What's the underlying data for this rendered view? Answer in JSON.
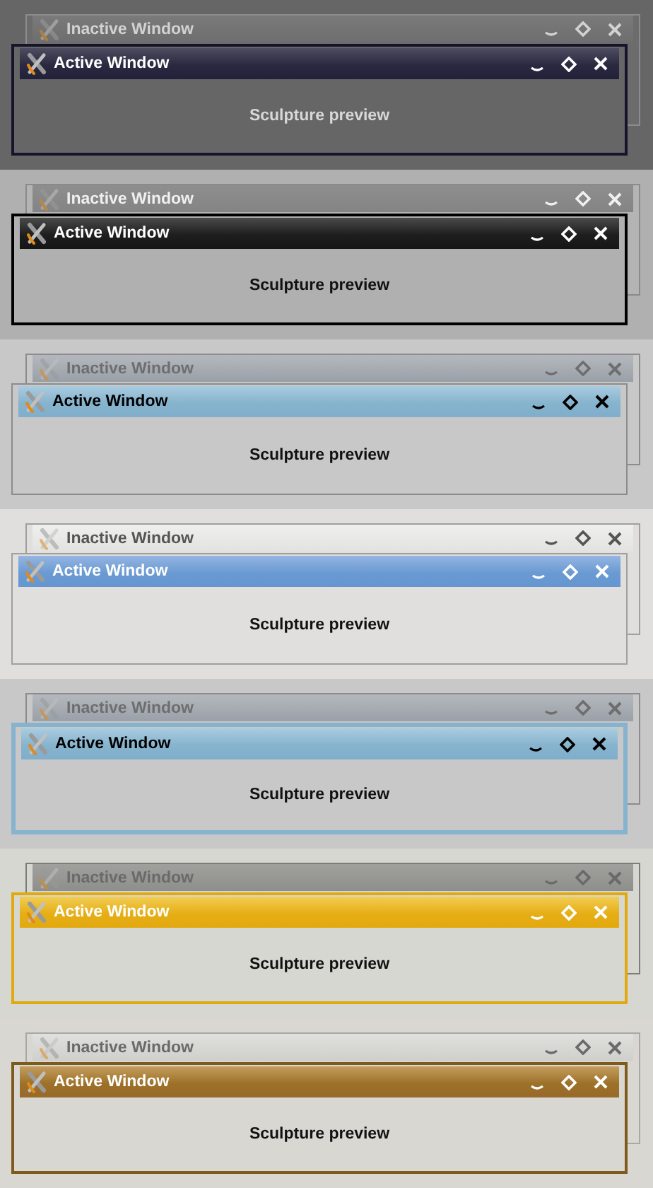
{
  "panels": [
    {
      "kind": "slate",
      "windows": [
        {
          "title": "Inactive Window",
          "active": false
        },
        {
          "title": "Active Window",
          "active": true,
          "body": "Sculpture preview"
        }
      ]
    },
    {
      "kind": "black",
      "windows": [
        {
          "title": "Inactive Window",
          "active": false
        },
        {
          "title": "Active Window",
          "active": true,
          "body": "Sculpture preview"
        }
      ]
    },
    {
      "kind": "sky",
      "windows": [
        {
          "title": "Inactive Window",
          "active": false
        },
        {
          "title": "Active Window",
          "active": true,
          "body": "Sculpture preview"
        }
      ]
    },
    {
      "kind": "azure",
      "windows": [
        {
          "title": "Inactive Window",
          "active": false
        },
        {
          "title": "Active Window",
          "active": true,
          "body": "Sculpture preview"
        }
      ]
    },
    {
      "kind": "skyframe",
      "windows": [
        {
          "title": "Inactive Window",
          "active": false
        },
        {
          "title": "Active Window",
          "active": true,
          "body": "Sculpture preview"
        }
      ]
    },
    {
      "kind": "amber",
      "windows": [
        {
          "title": "Inactive Window",
          "active": false
        },
        {
          "title": "Active Window",
          "active": true,
          "body": "Sculpture preview"
        }
      ]
    },
    {
      "kind": "bronze",
      "windows": [
        {
          "title": "Inactive Window",
          "active": false
        },
        {
          "title": "Active Window",
          "active": true,
          "body": "Sculpture preview"
        }
      ]
    }
  ]
}
